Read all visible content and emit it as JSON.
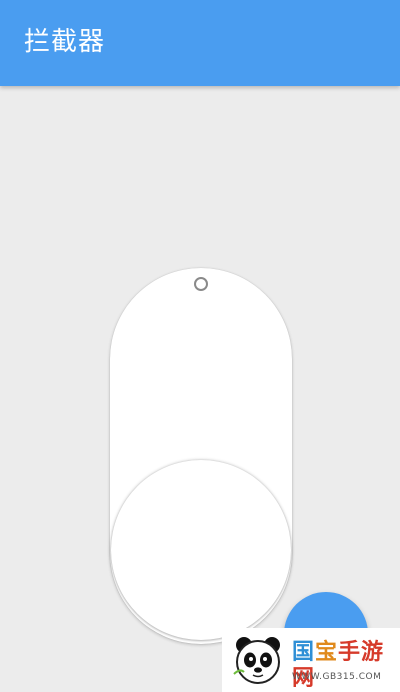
{
  "app": {
    "title": "拦截器"
  },
  "colors": {
    "primary": "#4a9df0",
    "background": "#ececec",
    "switch_track": "#ffffff"
  },
  "switch": {
    "state": "off",
    "icons": {
      "hole": "ring-icon"
    }
  },
  "fab": {
    "icon": "fab-icon"
  },
  "watermark": {
    "title_part0": "国",
    "title_part1": "宝",
    "title_part2": "手游网",
    "url": "WWW.GB315.COM",
    "logo": "panda-logo-icon"
  }
}
